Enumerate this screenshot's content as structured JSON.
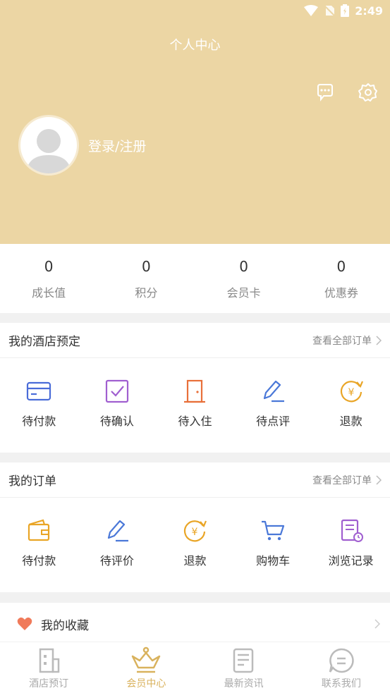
{
  "status_bar": {
    "time": "2:49"
  },
  "header": {
    "title": "个人中心",
    "login_text": "登录/注册"
  },
  "stats": [
    {
      "value": "0",
      "label": "成长值"
    },
    {
      "value": "0",
      "label": "积分"
    },
    {
      "value": "0",
      "label": "会员卡"
    },
    {
      "value": "0",
      "label": "优惠券"
    }
  ],
  "hotel_booking": {
    "title": "我的酒店预定",
    "link": "查看全部订单",
    "items": [
      {
        "label": "待付款",
        "icon": "card-icon"
      },
      {
        "label": "待确认",
        "icon": "check-icon"
      },
      {
        "label": "待入住",
        "icon": "door-icon"
      },
      {
        "label": "待点评",
        "icon": "pen-icon"
      },
      {
        "label": "退款",
        "icon": "refund-icon"
      }
    ]
  },
  "my_orders": {
    "title": "我的订单",
    "link": "查看全部订单",
    "items": [
      {
        "label": "待付款",
        "icon": "wallet-icon"
      },
      {
        "label": "待评价",
        "icon": "pen-icon"
      },
      {
        "label": "退款",
        "icon": "refund-icon"
      },
      {
        "label": "购物车",
        "icon": "cart-icon"
      },
      {
        "label": "浏览记录",
        "icon": "history-icon"
      }
    ]
  },
  "favorites": {
    "label": "我的收藏"
  },
  "tabbar": [
    {
      "label": "酒店预订",
      "icon": "building-icon",
      "active": false
    },
    {
      "label": "会员中心",
      "icon": "crown-icon",
      "active": true
    },
    {
      "label": "最新资讯",
      "icon": "news-icon",
      "active": false
    },
    {
      "label": "联系我们",
      "icon": "chat-icon",
      "active": false
    }
  ],
  "colors": {
    "header_bg": "#ecd6a4",
    "accent": "#d9b25d",
    "blue": "#4a78d8",
    "purple": "#a05fd0",
    "orange": "#e8823a",
    "gold": "#e9a526"
  }
}
